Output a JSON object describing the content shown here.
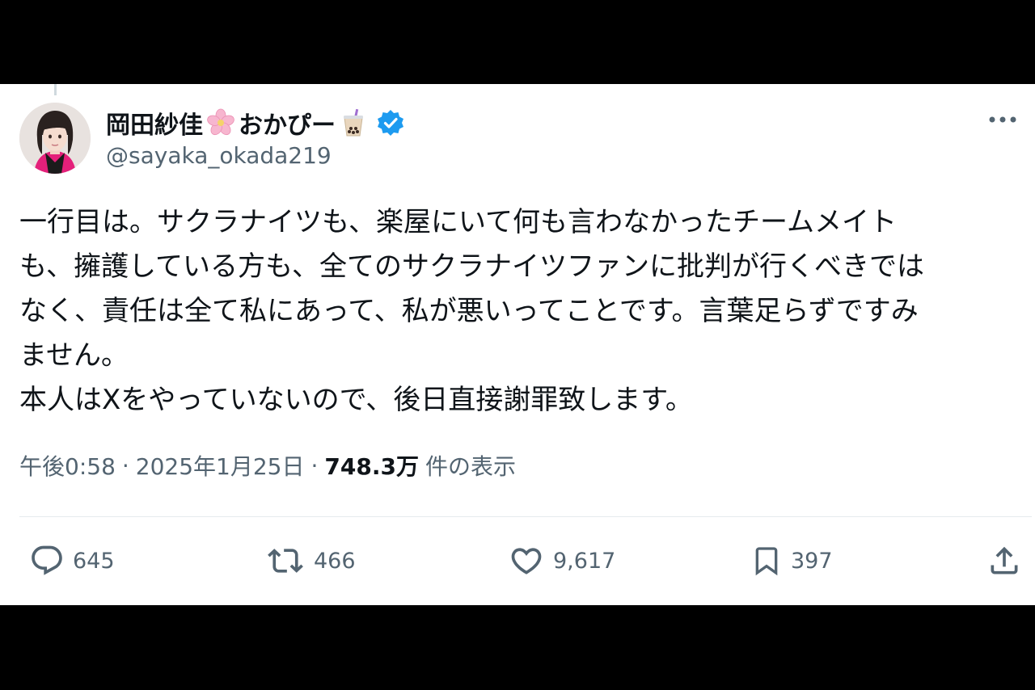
{
  "tweet": {
    "author": {
      "name_prefix": "岡田紗佳",
      "name_suffix": "おかぴー",
      "handle": "@sayaka_okada219",
      "verified": true,
      "name_emojis": [
        "cherry-blossom-icon",
        "bubble-tea-icon"
      ]
    },
    "text_lines": [
      "一行目は。サクラナイツも、楽屋にいて何も言わなかったチームメイト",
      "も、擁護している方も、全てのサクラナイツファンに批判が行くべきでは",
      "なく、責任は全て私にあって、私が悪いってことです。言葉足らずですみ",
      "ません。",
      "本人はXをやっていないので、後日直接謝罪致します。"
    ],
    "meta": {
      "time": "午後0:58",
      "separator": "·",
      "date": "2025年1月25日",
      "views": "748.3万",
      "views_label": "件の表示"
    },
    "actions": {
      "reply_count": "645",
      "retweet_count": "466",
      "like_count": "9,617",
      "bookmark_count": "397"
    }
  },
  "colors": {
    "text": "#0f1419",
    "secondary": "#536471",
    "verified_blue": "#1d9bf0",
    "divider": "#e6ebee"
  }
}
